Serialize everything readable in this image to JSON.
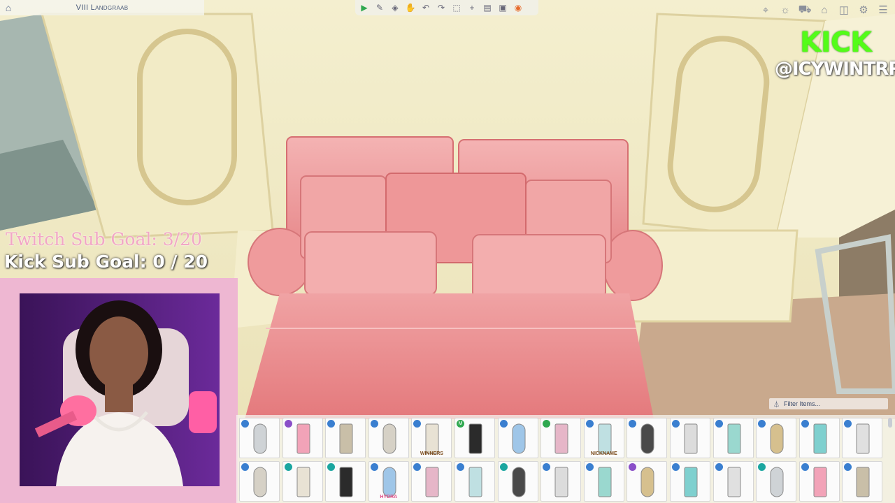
{
  "top_bar": {
    "lot_name": "VIII Landgraab",
    "build_tools": [
      "play-icon",
      "eyedropper-icon",
      "sledgehammer-icon",
      "hand-icon",
      "undo-icon",
      "redo-icon",
      "camera-icon",
      "add-icon",
      "floor-icon",
      "blueprint-icon",
      "gallery-icon"
    ],
    "right_tools": [
      "lot-info-icon",
      "lightbulb-icon",
      "cart-icon",
      "house-icon",
      "camera-icon",
      "settings-icon",
      "menu-icon"
    ]
  },
  "overlay": {
    "kick_logo": "KICK",
    "kick_handle": "@ICYWINTRR",
    "twitch_goal": "Twitch Sub Goal: 3/20",
    "kick_goal": "Kick Sub Goal: 0 / 20"
  },
  "catalog": {
    "filter_label": "Filter Items...",
    "items_row1": [
      {
        "name": "glass-panel-mirror",
        "badge": "blue"
      },
      {
        "name": "pink-vanity-mirror",
        "badge": "purple"
      },
      {
        "name": "framed-floor-mirror",
        "badge": "blue"
      },
      {
        "name": "angled-wall-mirror",
        "badge": "blue"
      },
      {
        "name": "winners-trophy-mirror",
        "badge": "blue",
        "label": "WINNERS"
      },
      {
        "name": "camera-item",
        "badge": "green",
        "badge_text": "M"
      },
      {
        "name": "cloud-sign-mirror",
        "badge": "blue"
      },
      {
        "name": "heart-mirror-set",
        "badge": "green"
      },
      {
        "name": "arched-nickname-mirror",
        "badge": "blue",
        "label": "NICKNAME"
      },
      {
        "name": "black-grid-mirror",
        "badge": "blue"
      },
      {
        "name": "round-silver-mirror",
        "badge": "blue"
      },
      {
        "name": "teal-standing-mirror",
        "badge": "blue"
      },
      {
        "name": "ornate-gold-mirror",
        "badge": "blue"
      },
      {
        "name": "round-teal-mirror",
        "badge": "blue"
      },
      {
        "name": "oval-stand-mirror",
        "badge": "blue"
      }
    ],
    "items_row2": [
      {
        "name": "tall-white-mirror",
        "badge": "blue"
      },
      {
        "name": "black-floor-mirror",
        "badge": "teal"
      },
      {
        "name": "black-ornate-mirror",
        "badge": "teal"
      },
      {
        "name": "hydra-pink-mirror",
        "badge": "blue",
        "label": "HYDRA"
      },
      {
        "name": "gold-arch-mirror",
        "badge": "blue"
      },
      {
        "name": "wood-lean-mirror",
        "badge": "blue"
      },
      {
        "name": "slim-gold-mirror",
        "badge": "teal"
      },
      {
        "name": "silver-panel-mirror",
        "badge": "blue"
      },
      {
        "name": "dark-stand-mirror",
        "badge": "blue"
      },
      {
        "name": "pale-floor-mirror",
        "badge": "purple"
      },
      {
        "name": "clear-lean-mirror",
        "badge": "blue"
      },
      {
        "name": "casa-mirror",
        "badge": "blue"
      },
      {
        "name": "teal-arch-mirror",
        "badge": "teal"
      },
      {
        "name": "bulb-vanity-mirror",
        "badge": "blue"
      },
      {
        "name": "wood-dresser-mirror",
        "badge": "blue"
      }
    ]
  },
  "colors": {
    "blue": "#3a7fd0",
    "purple": "#8a4fc8",
    "green": "#2fa84f",
    "teal": "#1ba6a0",
    "kick_green": "#53fc18",
    "twitch_pink": "#f2a6c6"
  }
}
